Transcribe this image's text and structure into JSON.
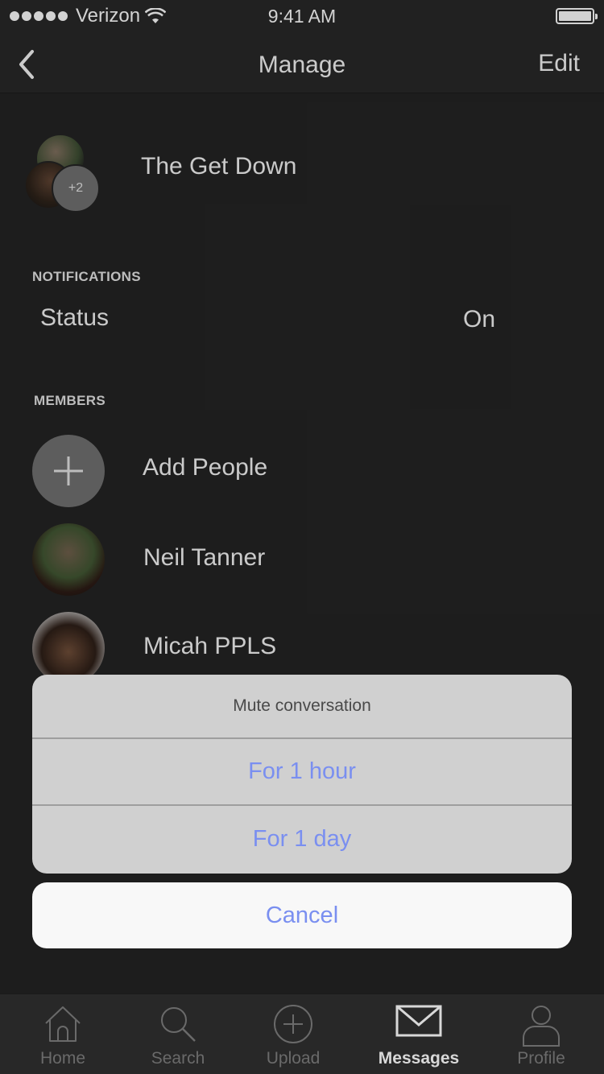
{
  "status_bar": {
    "carrier": "Verizon",
    "time": "9:41 AM"
  },
  "nav": {
    "title": "Manage",
    "edit_label": "Edit"
  },
  "group": {
    "name": "The Get Down",
    "extra_count": "+2"
  },
  "notifications": {
    "header": "NOTIFICATIONS",
    "status_label": "Status",
    "status_value": "On"
  },
  "members": {
    "header": "MEMBERS",
    "add_label": "Add People",
    "items": [
      {
        "name": "Neil Tanner"
      },
      {
        "name": "Micah PPLS"
      }
    ]
  },
  "action_sheet": {
    "title": "Mute conversation",
    "options": [
      "For 1 hour",
      "For 1 day"
    ],
    "cancel_label": "Cancel"
  },
  "tabs": [
    {
      "label": "Home",
      "icon": "home-icon"
    },
    {
      "label": "Search",
      "icon": "search-icon"
    },
    {
      "label": "Upload",
      "icon": "upload-icon"
    },
    {
      "label": "Messages",
      "icon": "envelope-icon",
      "active": true
    },
    {
      "label": "Profile",
      "icon": "profile-icon"
    }
  ]
}
